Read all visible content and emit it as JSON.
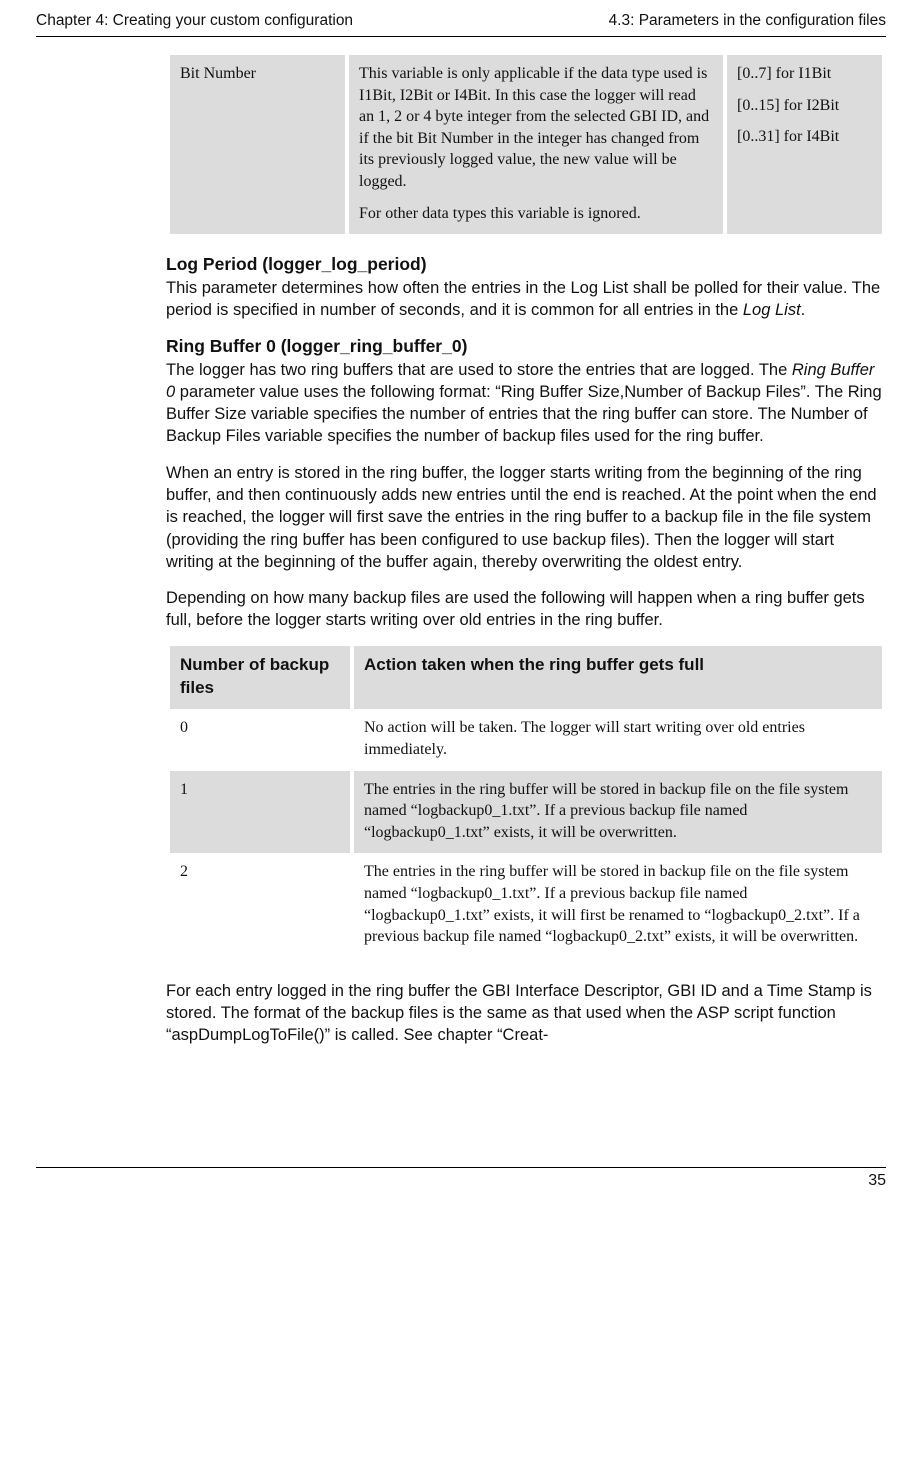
{
  "header": {
    "left": "Chapter 4: Creating your custom configuration",
    "right": "4.3: Parameters in the configuration files"
  },
  "table1": {
    "row": {
      "name": "Bit Number",
      "desc_p1": "This variable is only applicable if the data type used is I1Bit, I2Bit or I4Bit. In this case the logger will read an 1, 2 or 4 byte integer from the selected GBI ID, and if the bit Bit Number in the integer has changed from its previously logged value, the new value will be logged.",
      "desc_p2": "For other data types this variable is ignored.",
      "range_l1": "[0..7] for I1Bit",
      "range_l2": "[0..15] for I2Bit",
      "range_l3": "[0..31] for I4Bit"
    }
  },
  "sec1": {
    "title": "Log Period (logger_log_period)",
    "para_a": "This parameter determines how often the entries in the Log List shall be polled for their value. The period is specified in number of seconds, and it is common for all entries in the ",
    "para_it": "Log List",
    "para_b": "."
  },
  "sec2": {
    "title": "Ring Buffer 0 (logger_ring_buffer_0)",
    "p1_a": "The logger has two ring buffers that are used to store the entries that are logged. The ",
    "p1_it": "Ring Buffer 0",
    "p1_b": " parameter value uses the following format: “Ring Buffer Size,Number of Backup Files”. The Ring Buffer Size variable specifies the number of entries that the ring buffer can store. The Number of Backup Files variable specifies the number of backup files used for the ring buffer.",
    "p2": "When an entry is stored in the ring buffer, the logger starts writing from the beginning of the ring buffer, and then continuously adds new entries until the end is reached. At the point when the end is reached, the logger will first save the entries in the ring buffer to a backup file in the file system (providing the ring buffer has been configured to use backup files). Then the logger will start writing at the beginning of the buffer again, thereby overwriting the oldest entry.",
    "p3": "Depending on how many backup files are used the following will happen when a ring buffer gets full, before the logger starts writing over old entries in the ring buffer."
  },
  "table2": {
    "head": {
      "c1": "Number of backup files",
      "c2": "Action taken when the ring buffer gets full"
    },
    "rows": [
      {
        "n": "0",
        "txt": "No action will be taken. The logger will start writing over old entries immediately."
      },
      {
        "n": "1",
        "txt": "The entries in the ring buffer will be stored in backup file on the file system named “logbackup0_1.txt”. If a previous backup file named “logbackup0_1.txt” exists, it will be overwritten."
      },
      {
        "n": "2",
        "txt": "The entries in the ring buffer will be stored in backup file on the file system named “logbackup0_1.txt”. If a previous backup file named “logbackup0_1.txt” exists, it will first be renamed to “logbackup0_2.txt”. If a previous backup file named “logbackup0_2.txt” exists, it will be overwritten."
      }
    ]
  },
  "after": {
    "p": "For each entry logged in the ring buffer the GBI Interface Descriptor, GBI ID and a Time Stamp is stored. The format of the backup files is the same as that used when the ASP script function “aspDumpLogToFile()” is called. See chapter “Creat-"
  },
  "page_number": "35"
}
